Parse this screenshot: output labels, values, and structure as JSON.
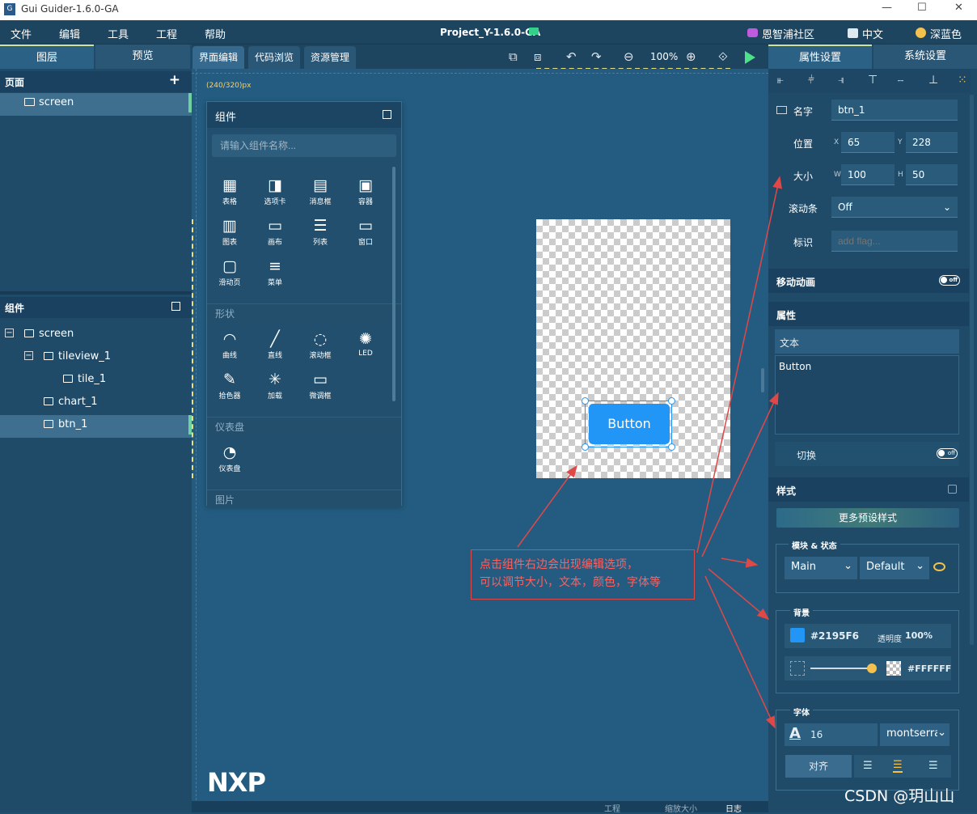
{
  "window": {
    "title": "Gui Guider-1.6.0-GA",
    "logo": "G",
    "minimize": "—",
    "maximize": "☐",
    "close": "✕"
  },
  "menu": {
    "items": [
      "文件",
      "编辑",
      "工具",
      "工程",
      "帮助"
    ],
    "project": "Project_Y-1.6.0-GA",
    "community": "恩智浦社区",
    "language": "中文",
    "theme": "深蓝色"
  },
  "left": {
    "tabs": [
      "图层",
      "预览"
    ],
    "pages_title": "页面",
    "pages_add": "+",
    "pages": [
      "screen"
    ],
    "widgets_title": "组件",
    "tree": [
      {
        "label": "screen",
        "level": 0,
        "expander": "−"
      },
      {
        "label": "tileview_1",
        "level": 1,
        "expander": "−"
      },
      {
        "label": "tile_1",
        "level": 2,
        "expander": ""
      },
      {
        "label": "chart_1",
        "level": 1,
        "expander": ""
      },
      {
        "label": "btn_1",
        "level": 1,
        "expander": "",
        "selected": true
      }
    ]
  },
  "editor": {
    "tabs": [
      "界面编辑",
      "代码浏览",
      "资源管理"
    ],
    "zoom": "100%",
    "size_label": "(240/320)px",
    "palette": {
      "title": "组件",
      "search_placeholder": "请输入组件名称...",
      "items_row1": [
        "表格",
        "选项卡",
        "消息框",
        "容器"
      ],
      "items_row2": [
        "图表",
        "画布",
        "列表",
        "窗口"
      ],
      "items_row3": [
        "滑动页",
        "菜单"
      ],
      "shapes_title": "形状",
      "shapes_row1": [
        "曲线",
        "直线",
        "滚动框",
        "LED"
      ],
      "shapes_row2": [
        "拾色器",
        "加载",
        "微调框"
      ],
      "meter_title": "仪表盘",
      "meter_items": [
        "仪表盘"
      ],
      "image_title": "图片"
    },
    "button_text": "Button",
    "annotation_line1": "点击组件右边会出现编辑选项，",
    "annotation_line2": "可以调节大小，文本，颜色，字体等",
    "brand": "NXP",
    "status_items": [
      "工程",
      "缩放大小",
      "日志"
    ]
  },
  "right": {
    "tabs": [
      "属性设置",
      "系统设置"
    ],
    "name_label": "名字",
    "name_value": "btn_1",
    "pos_label": "位置",
    "x_label": "X",
    "x_value": "65",
    "y_label": "Y",
    "y_value": "228",
    "size_label": "大小",
    "w_label": "W",
    "w_value": "100",
    "h_label": "H",
    "h_value": "50",
    "scroll_label": "滚动条",
    "scroll_value": "Off",
    "flag_label": "标识",
    "flag_placeholder": "add flag...",
    "anim_title": "移动动画",
    "toggle_off": "off",
    "attr_title": "属性",
    "text_label": "文本",
    "text_value": "Button",
    "switch_label": "切换",
    "style_title": "样式",
    "preset_btn": "更多预设样式",
    "part_state_label": "模块 & 状态",
    "part_value": "Main",
    "state_value": "Default",
    "bg_label": "背景",
    "bg_color": "#2195F6",
    "opacity_label": "透明度",
    "opacity_value": "100%",
    "grad_color": "#FFFFFF",
    "font_label": "字体",
    "font_size": "16",
    "font_name": "montserrat",
    "align_label": "对齐"
  },
  "watermark": "CSDN @玥山山",
  "colors": {
    "accent": "#2196F6",
    "annotation": "#e04848"
  }
}
